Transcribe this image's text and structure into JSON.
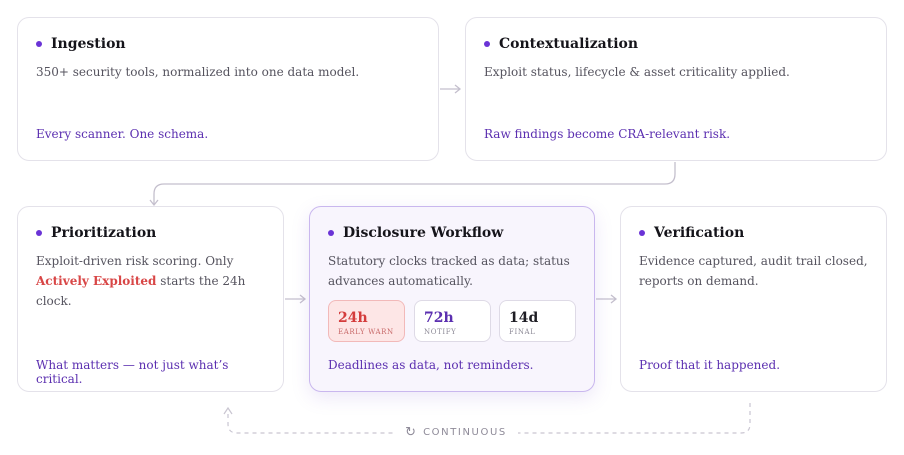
{
  "stages": {
    "ingestion": {
      "title": "Ingestion",
      "description": "350+ security tools, normalized into one data model.",
      "footer": "Every scanner. One schema."
    },
    "contextualization": {
      "title": "Contextualization",
      "description": "Exploit status, lifecycle & asset criticality applied.",
      "footer": "Raw findings become CRA-relevant risk."
    },
    "prioritization": {
      "title": "Prioritization",
      "description_pre": "Exploit-driven risk scoring. Only ",
      "description_highlight": "Actively Exploited",
      "description_post": " starts the 24h clock.",
      "footer": "What matters — not just what’s critical."
    },
    "disclosure": {
      "title": "Disclosure Workflow",
      "description": "Statutory clocks tracked as data; status advances automatically.",
      "footer": "Deadlines as data, not reminders.",
      "clocks": [
        {
          "value": "24h",
          "label": "EARLY WARN"
        },
        {
          "value": "72h",
          "label": "NOTIFY"
        },
        {
          "value": "14d",
          "label": "FINAL"
        }
      ]
    },
    "verification": {
      "title": "Verification",
      "description": "Evidence captured, audit trail closed, reports on demand.",
      "footer": "Proof that it happened."
    }
  },
  "loop": {
    "label": "CONTINUOUS",
    "icon": "refresh-icon"
  },
  "colors": {
    "accent": "#6a33d6",
    "link_text": "#5b2fb0",
    "highlight_red": "#d84646",
    "connector": "#c4bfcd"
  }
}
